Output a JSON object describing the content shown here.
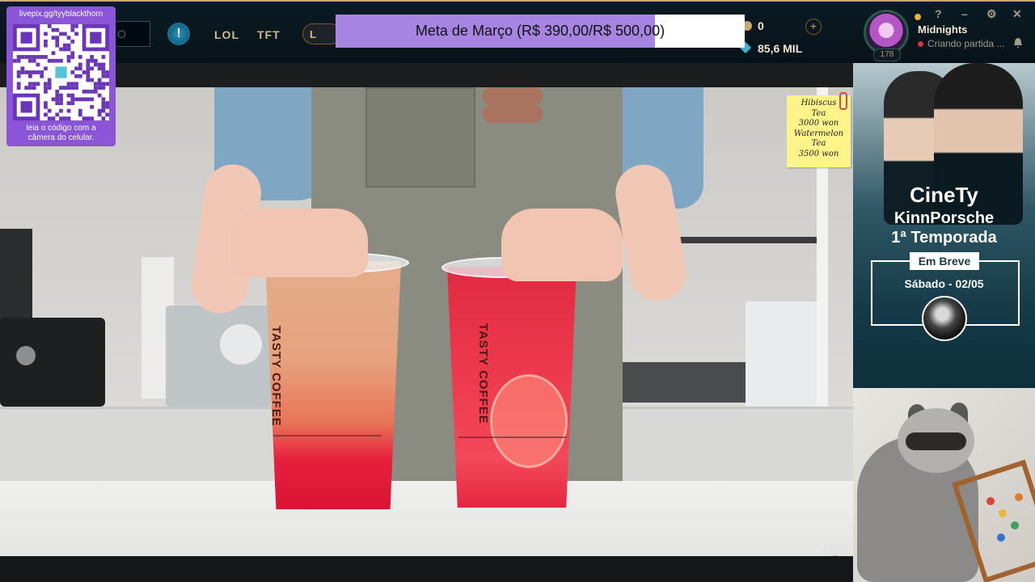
{
  "topbar": {
    "search_placeholder": "O",
    "alert_symbol": "!",
    "tabs": [
      "LOL",
      "TFT"
    ],
    "loot_label": "L",
    "currency": {
      "rp_value": "0",
      "blue_essence_value": "85,6 MIL"
    },
    "plus_symbol": "+",
    "profile": {
      "level": "178",
      "summoner_name": "Midnights",
      "status": "Criando partida ..."
    },
    "window_buttons": [
      "?",
      "⚙",
      "✕"
    ],
    "minimize_symbol": "–"
  },
  "goal_bar": {
    "label": "Meta de Março (R$ 390,00/R$ 500,00)",
    "progress": 0.78,
    "fill_color": "#a685e2"
  },
  "qr_overlay": {
    "url": "livepix.gg/tyyblackthorn",
    "caption_line1": "leia o código com a",
    "caption_line2": "câmera do celular.",
    "background_color": "#8a55d6"
  },
  "video": {
    "price_note": {
      "line1": "Hibiscus",
      "line2": "Tea",
      "line3": "3000 won",
      "line4": "Watermelon",
      "line5": "Tea",
      "line6": "3500 won"
    },
    "cup_brand_left": "TASTY COFFEE",
    "cup_brand_right": "TASTY COFFEE",
    "corner_button_icon": "expand-icon"
  },
  "promo": {
    "brand": "CineTy",
    "title_line1": "KinnPorsche",
    "title_line2": "1ª Temporada",
    "badge": "Em Breve",
    "date": "Sábado - 02/05"
  }
}
